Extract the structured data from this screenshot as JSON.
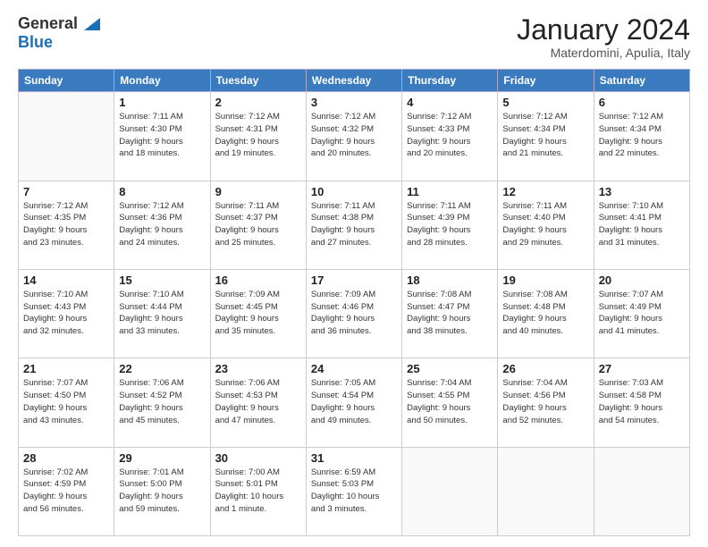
{
  "header": {
    "logo_line1": "General",
    "logo_line2": "Blue",
    "month": "January 2024",
    "location": "Materdomini, Apulia, Italy"
  },
  "weekdays": [
    "Sunday",
    "Monday",
    "Tuesday",
    "Wednesday",
    "Thursday",
    "Friday",
    "Saturday"
  ],
  "weeks": [
    [
      {
        "day": "",
        "info": ""
      },
      {
        "day": "1",
        "info": "Sunrise: 7:11 AM\nSunset: 4:30 PM\nDaylight: 9 hours\nand 18 minutes."
      },
      {
        "day": "2",
        "info": "Sunrise: 7:12 AM\nSunset: 4:31 PM\nDaylight: 9 hours\nand 19 minutes."
      },
      {
        "day": "3",
        "info": "Sunrise: 7:12 AM\nSunset: 4:32 PM\nDaylight: 9 hours\nand 20 minutes."
      },
      {
        "day": "4",
        "info": "Sunrise: 7:12 AM\nSunset: 4:33 PM\nDaylight: 9 hours\nand 20 minutes."
      },
      {
        "day": "5",
        "info": "Sunrise: 7:12 AM\nSunset: 4:34 PM\nDaylight: 9 hours\nand 21 minutes."
      },
      {
        "day": "6",
        "info": "Sunrise: 7:12 AM\nSunset: 4:34 PM\nDaylight: 9 hours\nand 22 minutes."
      }
    ],
    [
      {
        "day": "7",
        "info": "Sunrise: 7:12 AM\nSunset: 4:35 PM\nDaylight: 9 hours\nand 23 minutes."
      },
      {
        "day": "8",
        "info": "Sunrise: 7:12 AM\nSunset: 4:36 PM\nDaylight: 9 hours\nand 24 minutes."
      },
      {
        "day": "9",
        "info": "Sunrise: 7:11 AM\nSunset: 4:37 PM\nDaylight: 9 hours\nand 25 minutes."
      },
      {
        "day": "10",
        "info": "Sunrise: 7:11 AM\nSunset: 4:38 PM\nDaylight: 9 hours\nand 27 minutes."
      },
      {
        "day": "11",
        "info": "Sunrise: 7:11 AM\nSunset: 4:39 PM\nDaylight: 9 hours\nand 28 minutes."
      },
      {
        "day": "12",
        "info": "Sunrise: 7:11 AM\nSunset: 4:40 PM\nDaylight: 9 hours\nand 29 minutes."
      },
      {
        "day": "13",
        "info": "Sunrise: 7:10 AM\nSunset: 4:41 PM\nDaylight: 9 hours\nand 31 minutes."
      }
    ],
    [
      {
        "day": "14",
        "info": "Sunrise: 7:10 AM\nSunset: 4:43 PM\nDaylight: 9 hours\nand 32 minutes."
      },
      {
        "day": "15",
        "info": "Sunrise: 7:10 AM\nSunset: 4:44 PM\nDaylight: 9 hours\nand 33 minutes."
      },
      {
        "day": "16",
        "info": "Sunrise: 7:09 AM\nSunset: 4:45 PM\nDaylight: 9 hours\nand 35 minutes."
      },
      {
        "day": "17",
        "info": "Sunrise: 7:09 AM\nSunset: 4:46 PM\nDaylight: 9 hours\nand 36 minutes."
      },
      {
        "day": "18",
        "info": "Sunrise: 7:08 AM\nSunset: 4:47 PM\nDaylight: 9 hours\nand 38 minutes."
      },
      {
        "day": "19",
        "info": "Sunrise: 7:08 AM\nSunset: 4:48 PM\nDaylight: 9 hours\nand 40 minutes."
      },
      {
        "day": "20",
        "info": "Sunrise: 7:07 AM\nSunset: 4:49 PM\nDaylight: 9 hours\nand 41 minutes."
      }
    ],
    [
      {
        "day": "21",
        "info": "Sunrise: 7:07 AM\nSunset: 4:50 PM\nDaylight: 9 hours\nand 43 minutes."
      },
      {
        "day": "22",
        "info": "Sunrise: 7:06 AM\nSunset: 4:52 PM\nDaylight: 9 hours\nand 45 minutes."
      },
      {
        "day": "23",
        "info": "Sunrise: 7:06 AM\nSunset: 4:53 PM\nDaylight: 9 hours\nand 47 minutes."
      },
      {
        "day": "24",
        "info": "Sunrise: 7:05 AM\nSunset: 4:54 PM\nDaylight: 9 hours\nand 49 minutes."
      },
      {
        "day": "25",
        "info": "Sunrise: 7:04 AM\nSunset: 4:55 PM\nDaylight: 9 hours\nand 50 minutes."
      },
      {
        "day": "26",
        "info": "Sunrise: 7:04 AM\nSunset: 4:56 PM\nDaylight: 9 hours\nand 52 minutes."
      },
      {
        "day": "27",
        "info": "Sunrise: 7:03 AM\nSunset: 4:58 PM\nDaylight: 9 hours\nand 54 minutes."
      }
    ],
    [
      {
        "day": "28",
        "info": "Sunrise: 7:02 AM\nSunset: 4:59 PM\nDaylight: 9 hours\nand 56 minutes."
      },
      {
        "day": "29",
        "info": "Sunrise: 7:01 AM\nSunset: 5:00 PM\nDaylight: 9 hours\nand 59 minutes."
      },
      {
        "day": "30",
        "info": "Sunrise: 7:00 AM\nSunset: 5:01 PM\nDaylight: 10 hours\nand 1 minute."
      },
      {
        "day": "31",
        "info": "Sunrise: 6:59 AM\nSunset: 5:03 PM\nDaylight: 10 hours\nand 3 minutes."
      },
      {
        "day": "",
        "info": ""
      },
      {
        "day": "",
        "info": ""
      },
      {
        "day": "",
        "info": ""
      }
    ]
  ]
}
